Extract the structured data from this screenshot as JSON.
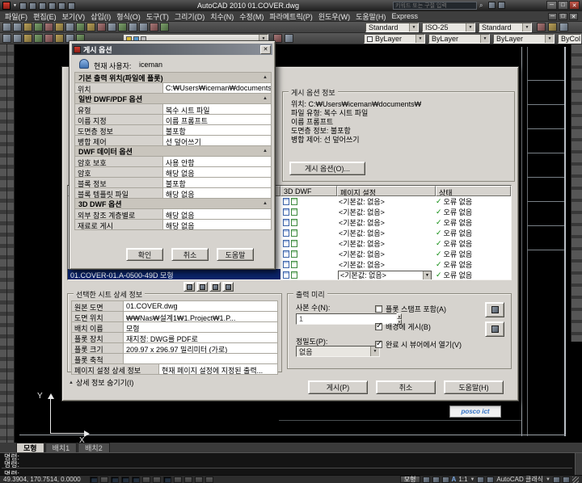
{
  "colors": {
    "selection_blue": "#0a246a",
    "dialog_gray": "#d6d3ce",
    "status_green": "#0a8a0a",
    "logo_blue": "#2f6fc4"
  },
  "icons": {
    "close": "✕",
    "minimize": "─",
    "maximize": "□",
    "dropdown": "▼",
    "collapse": "▲",
    "check": "✓",
    "search": "⌕",
    "up": "▲",
    "down": "▼"
  },
  "window": {
    "title": "AutoCAD 2010   01.COVER.dwg",
    "search_placeholder": "키워드 또는 구절 입력"
  },
  "menubar": {
    "items": [
      "파일(F)",
      "편집(E)",
      "보기(V)",
      "삽입(I)",
      "형식(O)",
      "도구(T)",
      "그리기(D)",
      "치수(N)",
      "수정(M)",
      "파라메트릭(P)",
      "윈도우(W)",
      "도움말(H)",
      "Express"
    ]
  },
  "toolbars": {
    "text_style": "Standard",
    "dim_style": "ISO-25",
    "table_style": "Standard",
    "color": "ByLayer",
    "linetype": "ByLayer",
    "lineweight": "ByLayer",
    "plot_style": "ByColor"
  },
  "options_dialog": {
    "title": "게시 옵션",
    "user_label": "현재 사용자:",
    "user": "iceman",
    "sections": [
      {
        "header": "기본 출력 위치(파일에 플롯)",
        "rows": [
          {
            "label": "위치",
            "value": "C:₩Users₩iceman₩documents₩"
          }
        ]
      },
      {
        "header": "일반 DWF/PDF 옵션",
        "rows": [
          {
            "label": "유형",
            "value": "복수 시트 파일"
          },
          {
            "label": "이름 지정",
            "value": "이름 프롬프트"
          },
          {
            "label": "도면층 정보",
            "value": "불포함"
          },
          {
            "label": "병합 제어",
            "value": "선 덮어쓰기"
          }
        ]
      },
      {
        "header": "DWF 데이터 옵션",
        "rows": [
          {
            "label": "암호 보호",
            "value": "사용 안함"
          },
          {
            "label": "암호",
            "value": "해당 없음"
          },
          {
            "label": "블록 정보",
            "value": "불포함"
          },
          {
            "label": "블록 템플릿 파일",
            "value": "해당 없음"
          }
        ]
      },
      {
        "header": "3D DWF 옵션",
        "rows": [
          {
            "label": "외부 참조 계층별로",
            "value": "해당 없음"
          },
          {
            "label": "재료로 게시",
            "value": "해당 없음"
          }
        ]
      }
    ],
    "ok": "확인",
    "cancel": "취소",
    "help": "도움말"
  },
  "publish_dialog": {
    "info": {
      "title": "게시 옵션 정보",
      "lines": [
        "위치: C:₩Users₩iceman₩documents₩",
        "파일 유형: 복수 시트 파일",
        "이름 프롬프트",
        "도면층 정보: 불포함",
        "병합 제어: 선 덮어쓰기"
      ],
      "options_button": "게시 옵션(O)..."
    },
    "sheet_table": {
      "headers": {
        "dwf3d": "3D DWF",
        "page_setup": "페이지 설정",
        "status": "상태"
      },
      "default_page_setup": "<기본값: 없음>",
      "status_ok": "오류 없음",
      "selected_sheet": "01.COVER-01.A-0500-49D 모형"
    },
    "details": {
      "title": "선택한 시트 상세 정보",
      "rows": [
        {
          "label": "원본 도면",
          "value": "01.COVER.dwg"
        },
        {
          "label": "도면 위치",
          "value": "₩₩Nas₩설계1₩1.Project₩1.P..."
        },
        {
          "label": "배치 이름",
          "value": "모형"
        },
        {
          "label": "플롯 장치",
          "value": "재지정: DWG를 PDF로"
        },
        {
          "label": "플롯 크기",
          "value": "209.97 x 296.97 밀리미터 (가로)"
        },
        {
          "label": "플롯 축척",
          "value": ""
        },
        {
          "label": "페이지 설정 상세 정보",
          "value": "현재 페이지 설정에 지정된 출력..."
        }
      ]
    },
    "hide_details": "상세 정보 숨기기(I)",
    "output": {
      "title": "출력 미리",
      "copies_label": "사본 수(N):",
      "copies_value": "1",
      "precision_label": "정밀도(P):",
      "precision_value": "없음",
      "checkboxes": [
        {
          "label": "플롯 스탬프 포함(A)",
          "checked": false
        },
        {
          "label": "배경에 게시(B)",
          "checked": true
        },
        {
          "label": "완료 시 뷰어에서 열기(V)",
          "checked": true
        }
      ]
    },
    "publish_button": "게시(P)",
    "cancel_button": "취소",
    "help_button": "도움말(H)"
  },
  "canvas": {
    "logo": "posco ict",
    "axis_x": "X",
    "axis_y": "Y"
  },
  "command": {
    "history": [
      "명령:",
      "명령:"
    ],
    "prompt": "명령:"
  },
  "layout_tabs": [
    "모형",
    "배치1",
    "배치2"
  ],
  "statusbar": {
    "coords": "49.3904, 170.7514, 0.0000",
    "model_button": "모형",
    "annotation_letter": "A",
    "scale": "1:1",
    "workspace": "AutoCAD 클래식"
  }
}
